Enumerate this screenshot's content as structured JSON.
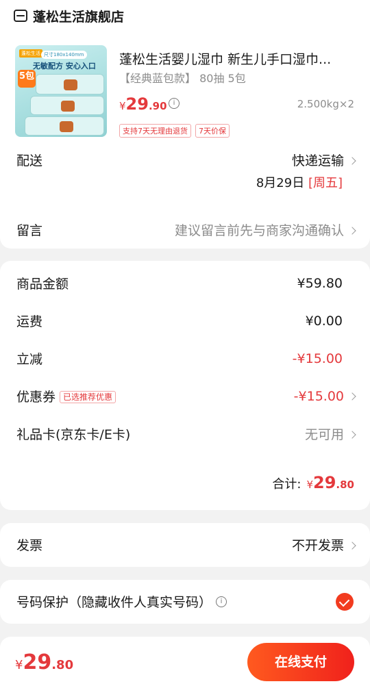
{
  "store": {
    "name": "蓬松生活旗舰店",
    "icon": "store-icon"
  },
  "product": {
    "title": "蓬松生活婴儿湿巾 新生儿手口湿巾...",
    "spec": "【经典蓝包款】 80抽 5包",
    "price_symbol": "¥",
    "price_int": "29",
    "price_dec": ".90",
    "weight": "2.500kg×2",
    "tags": [
      "支持7天无理由退货",
      "7天价保"
    ],
    "image": {
      "brand": "蓬松生活",
      "size_label": "尺寸180x140mm",
      "slogan": "无敏配方 安心入口",
      "badge": "5包"
    }
  },
  "delivery": {
    "label": "配送",
    "method": "快递运输",
    "date": "8月29日",
    "weekday": "[周五]"
  },
  "message": {
    "label": "留言",
    "placeholder": "建议留言前先与商家沟通确认"
  },
  "amounts": {
    "goods_label": "商品金额",
    "goods_value": "¥59.80",
    "shipping_label": "运费",
    "shipping_value": "¥0.00",
    "discount_label": "立减",
    "discount_value": "-¥15.00",
    "coupon_label": "优惠券",
    "coupon_badge": "已选推荐优惠",
    "coupon_value": "-¥15.00",
    "giftcard_label": "礼品卡(京东卡/E卡)",
    "giftcard_value": "无可用",
    "total_label": "合计:",
    "total_symbol": "¥",
    "total_int": "29",
    "total_dec": ".80"
  },
  "invoice": {
    "label": "发票",
    "value": "不开发票"
  },
  "protect": {
    "label": "号码保护（隐藏收件人真实号码）",
    "checked": true
  },
  "footer": {
    "symbol": "¥",
    "amount_int": "29",
    "amount_dec": ".80",
    "pay_label": "在线支付"
  },
  "colors": {
    "accent": "#e4393c",
    "button_start": "#ff5a1f",
    "button_end": "#f0211c"
  }
}
